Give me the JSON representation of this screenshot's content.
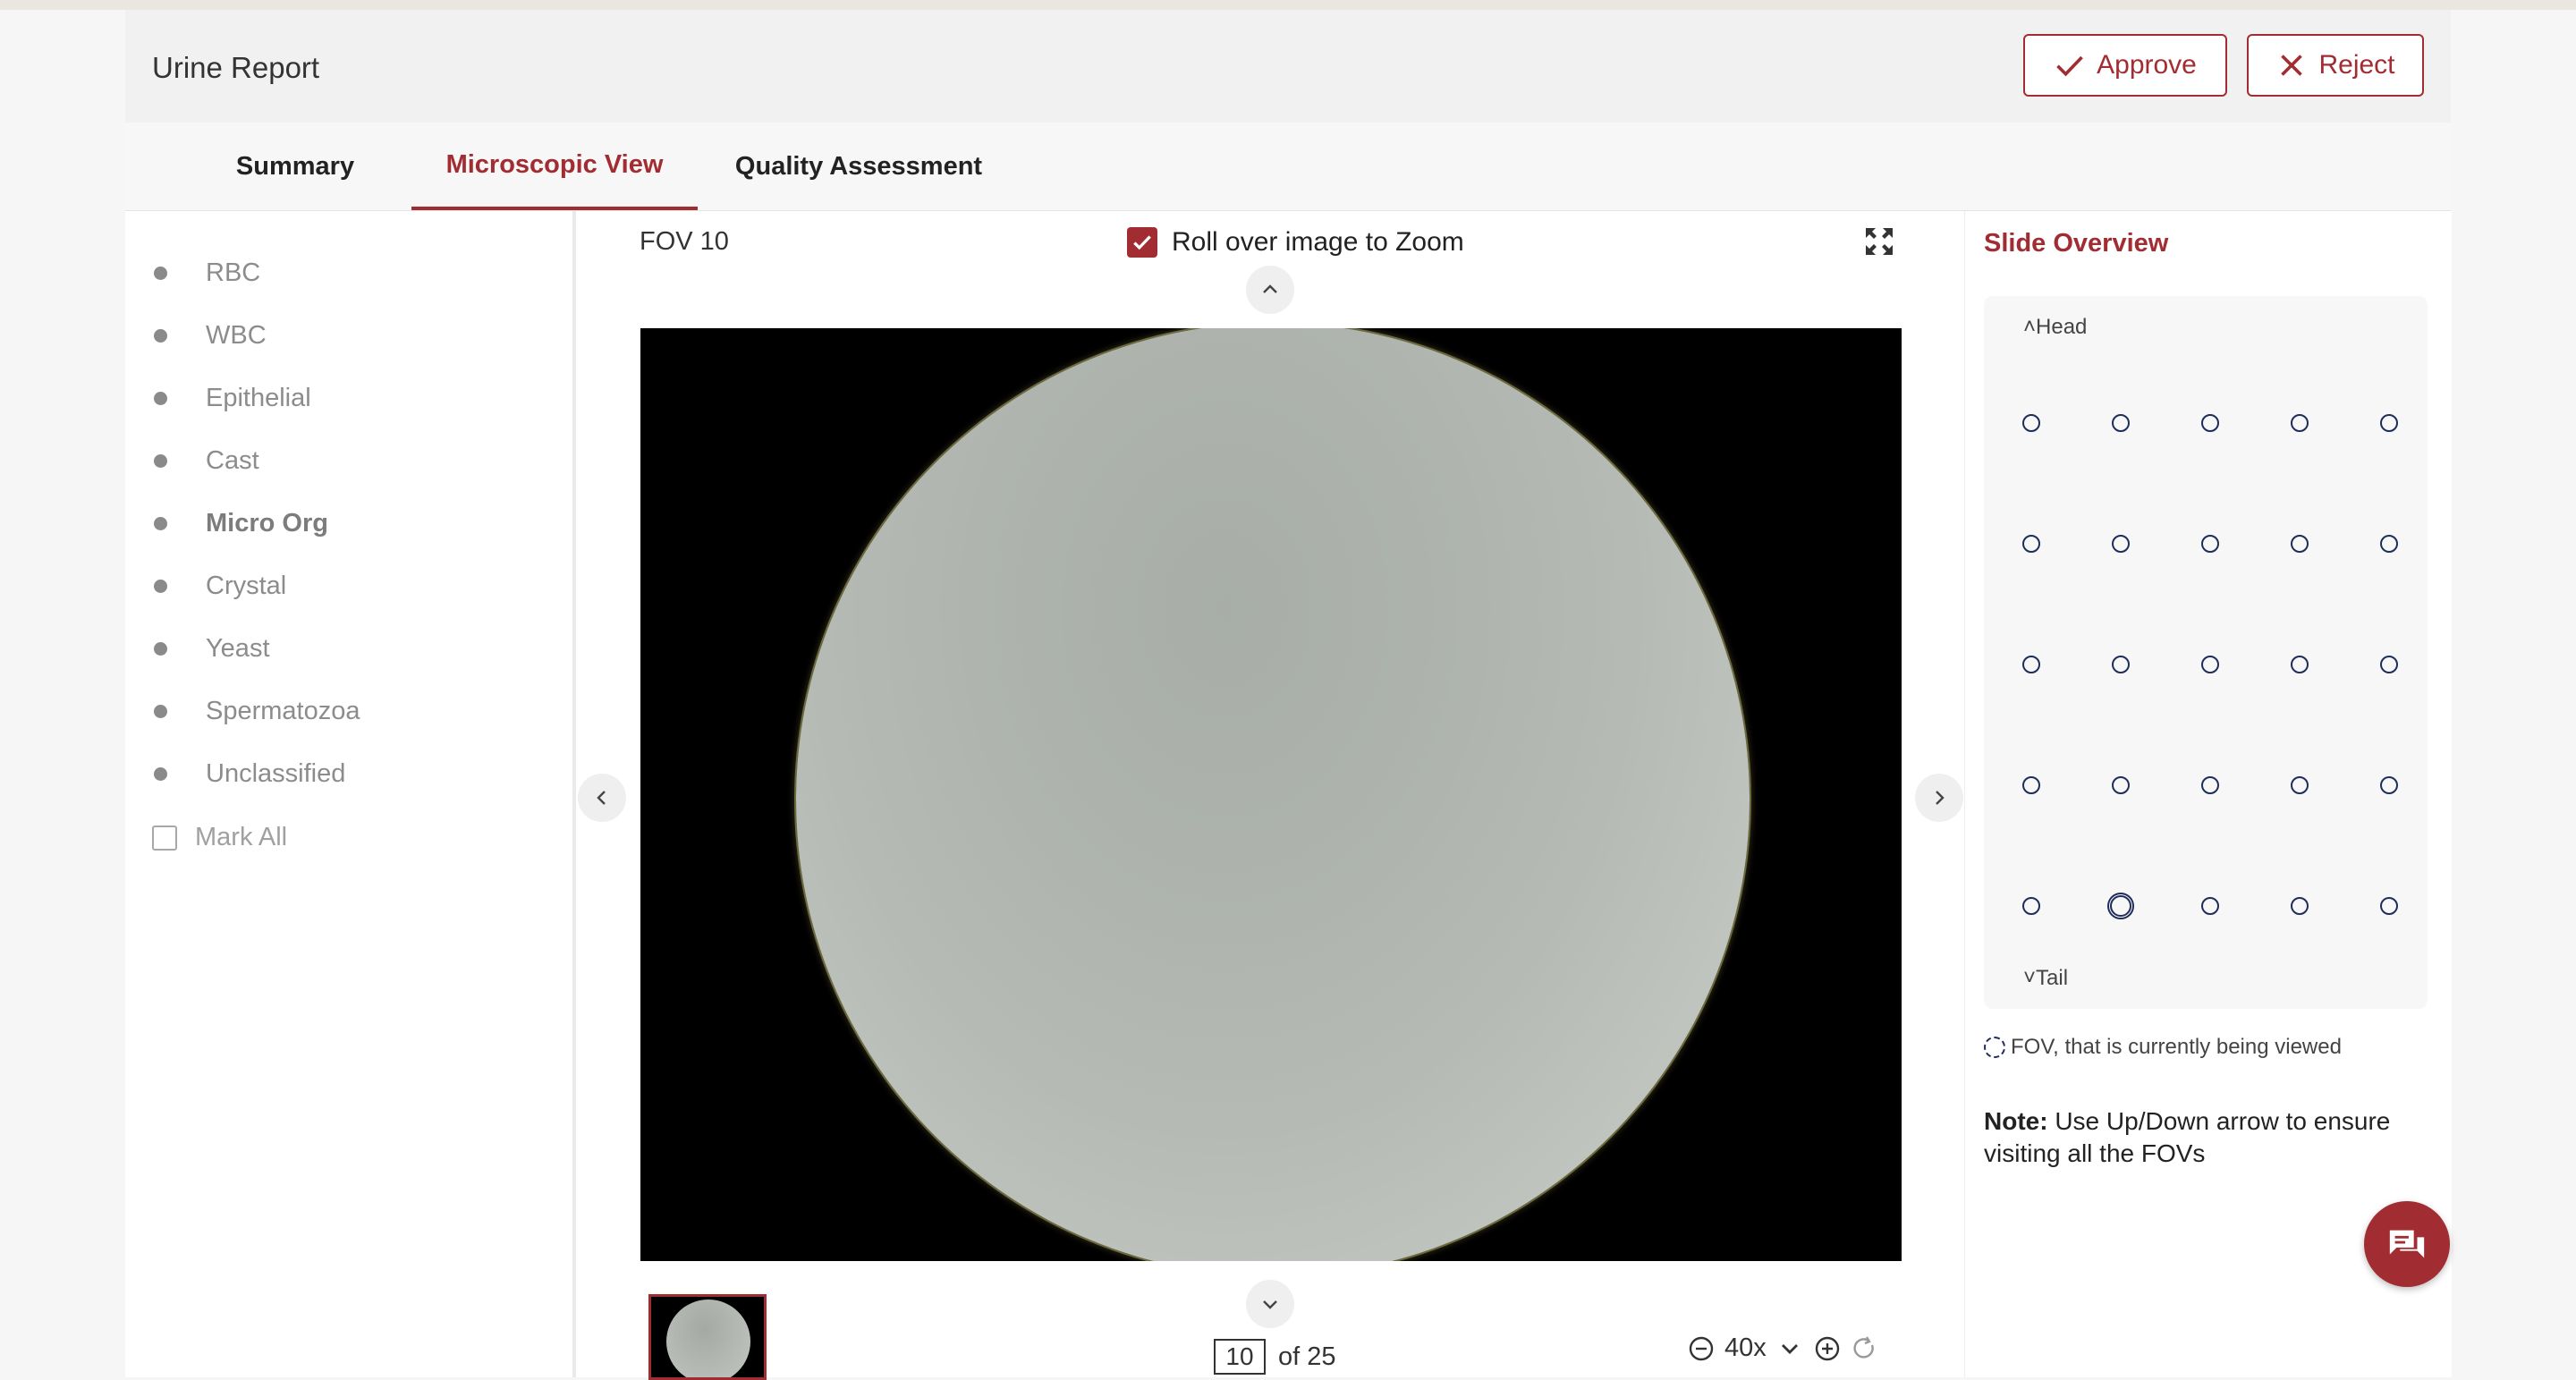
{
  "report": {
    "title": "Urine Report"
  },
  "actions": {
    "approve_label": "Approve",
    "reject_label": "Reject"
  },
  "tabs": [
    {
      "label": "Summary",
      "active": false
    },
    {
      "label": "Microscopic View",
      "active": true
    },
    {
      "label": "Quality Assessment",
      "active": false
    }
  ],
  "legend": {
    "items": [
      "RBC",
      "WBC",
      "Epithelial",
      "Cast",
      "Micro Org",
      "Crystal",
      "Yeast",
      "Spermatozoa",
      "Unclassified"
    ],
    "emphasized": "Micro Org",
    "mark_all_label": "Mark All",
    "mark_all_checked": false
  },
  "viewer": {
    "fov_label": "FOV 10",
    "zoom_toggle_label": "Roll over image to Zoom",
    "zoom_toggle_checked": true,
    "current_page": "10",
    "total_label": "of 25",
    "zoom_level": "40x"
  },
  "slide_overview": {
    "title": "Slide Overview",
    "head_label": "Head",
    "tail_label": "Tail",
    "grid_rows": 5,
    "grid_cols": 5,
    "current_fov": {
      "row": 5,
      "col": 2
    },
    "legend_text": "FOV, that is currently being viewed",
    "note_prefix": "Note:",
    "note_text": " Use Up/Down arrow to ensure visiting all the FOVs"
  },
  "colors": {
    "accent": "#a12d33",
    "dot": "#1f2d5a"
  }
}
